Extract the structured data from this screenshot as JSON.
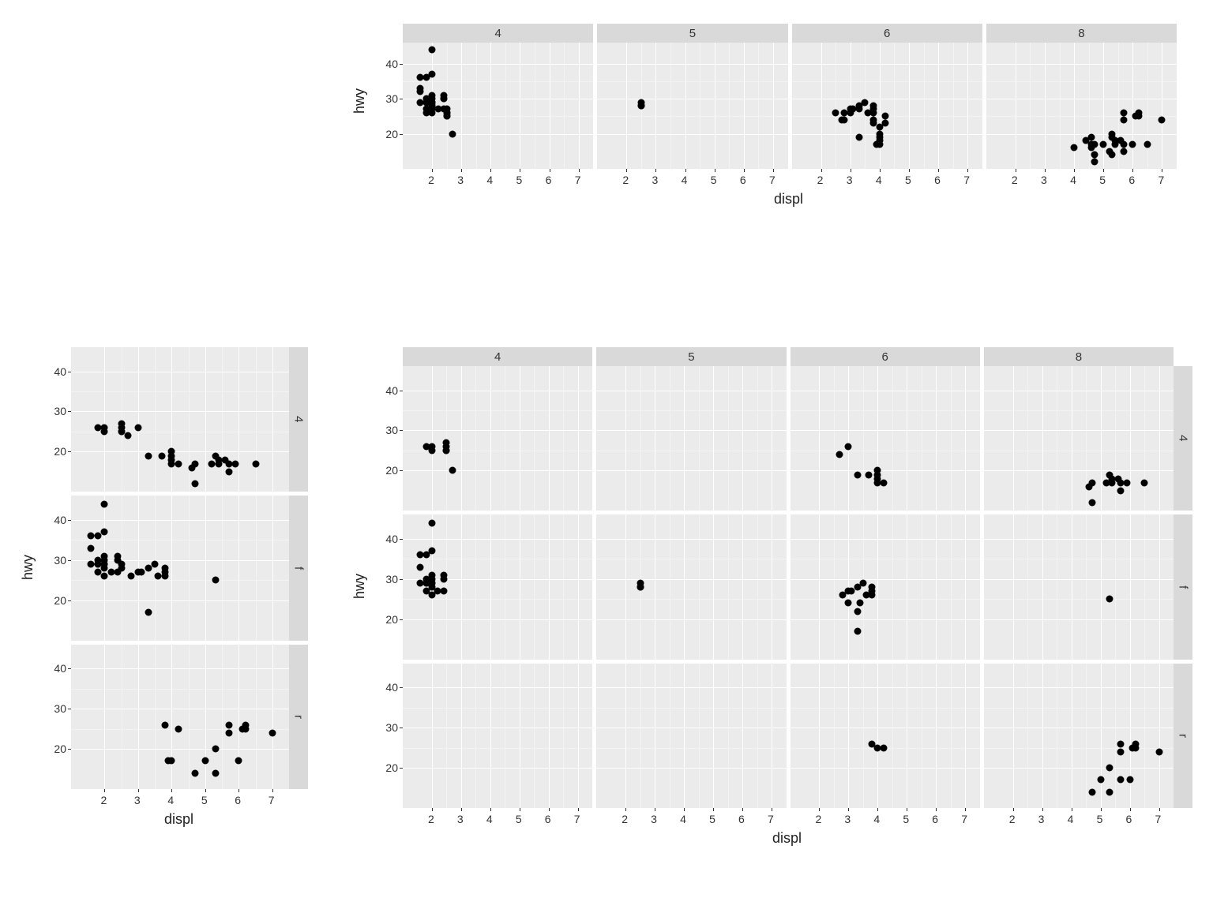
{
  "chart_data": [
    {
      "id": "A_top_right",
      "type": "scatter",
      "facets_col": [
        "4",
        "5",
        "6",
        "8"
      ],
      "xlabel": "displ",
      "ylabel": "hwy",
      "xlim": [
        1,
        7.5
      ],
      "ylim": [
        10,
        46
      ],
      "x_ticks": [
        2,
        3,
        4,
        5,
        6,
        7
      ],
      "y_ticks": [
        20,
        30,
        40
      ],
      "series_by_col": {
        "4": [
          [
            1.6,
            33
          ],
          [
            1.6,
            29
          ],
          [
            1.6,
            32
          ],
          [
            1.6,
            36
          ],
          [
            1.8,
            29
          ],
          [
            1.8,
            29
          ],
          [
            1.8,
            30
          ],
          [
            1.8,
            26
          ],
          [
            1.8,
            27
          ],
          [
            1.8,
            36
          ],
          [
            2.0,
            31
          ],
          [
            2.0,
            26
          ],
          [
            2.0,
            29
          ],
          [
            2.0,
            28
          ],
          [
            2.0,
            30
          ],
          [
            2.0,
            29
          ],
          [
            2.0,
            28
          ],
          [
            2.0,
            27
          ],
          [
            2.0,
            29
          ],
          [
            2.0,
            29
          ],
          [
            2.0,
            37
          ],
          [
            2.0,
            44
          ],
          [
            2.2,
            27
          ],
          [
            2.4,
            30
          ],
          [
            2.4,
            31
          ],
          [
            2.4,
            27
          ],
          [
            2.4,
            30
          ],
          [
            2.5,
            25
          ],
          [
            2.5,
            26
          ],
          [
            2.5,
            27
          ],
          [
            2.5,
            26
          ],
          [
            2.5,
            25
          ],
          [
            2.5,
            25
          ],
          [
            2.7,
            20
          ]
        ],
        "5": [
          [
            2.5,
            28
          ],
          [
            2.5,
            29
          ],
          [
            2.5,
            28
          ],
          [
            2.5,
            28
          ]
        ],
        "6": [
          [
            2.5,
            26
          ],
          [
            2.7,
            24
          ],
          [
            2.8,
            26
          ],
          [
            2.8,
            24
          ],
          [
            3.0,
            26
          ],
          [
            3.0,
            27
          ],
          [
            3.1,
            27
          ],
          [
            3.3,
            28
          ],
          [
            3.3,
            27
          ],
          [
            3.3,
            19
          ],
          [
            3.5,
            29
          ],
          [
            3.6,
            26
          ],
          [
            3.8,
            26
          ],
          [
            3.8,
            28
          ],
          [
            3.8,
            27
          ],
          [
            3.8,
            23
          ],
          [
            3.8,
            24
          ],
          [
            3.9,
            17
          ],
          [
            4.0,
            17
          ],
          [
            4.0,
            19
          ],
          [
            4.0,
            20
          ],
          [
            4.0,
            18
          ],
          [
            4.0,
            22
          ],
          [
            4.2,
            25
          ],
          [
            4.2,
            23
          ]
        ],
        "8": [
          [
            4.0,
            16
          ],
          [
            4.4,
            18
          ],
          [
            4.6,
            16
          ],
          [
            4.6,
            17
          ],
          [
            4.6,
            19
          ],
          [
            4.7,
            17
          ],
          [
            4.7,
            12
          ],
          [
            4.7,
            14
          ],
          [
            5.0,
            17
          ],
          [
            5.2,
            15
          ],
          [
            5.3,
            19
          ],
          [
            5.3,
            20
          ],
          [
            5.3,
            14
          ],
          [
            5.4,
            17
          ],
          [
            5.4,
            18
          ],
          [
            5.6,
            18
          ],
          [
            5.7,
            26
          ],
          [
            5.7,
            17
          ],
          [
            5.7,
            15
          ],
          [
            5.7,
            24
          ],
          [
            6.0,
            17
          ],
          [
            6.1,
            25
          ],
          [
            6.2,
            26
          ],
          [
            6.2,
            25
          ],
          [
            6.5,
            17
          ],
          [
            7.0,
            24
          ]
        ]
      }
    },
    {
      "id": "B_bottom_left",
      "type": "scatter",
      "facets_row": [
        "4",
        "f",
        "r"
      ],
      "xlabel": "displ",
      "ylabel": "hwy",
      "xlim": [
        1,
        7.5
      ],
      "ylim": [
        10,
        46
      ],
      "x_ticks": [
        2,
        3,
        4,
        5,
        6,
        7
      ],
      "y_ticks": [
        20,
        30,
        40
      ],
      "series_by_row": {
        "4": [
          [
            1.8,
            26
          ],
          [
            2.0,
            26
          ],
          [
            2.0,
            25
          ],
          [
            2.5,
            26
          ],
          [
            2.5,
            25
          ],
          [
            2.5,
            27
          ],
          [
            2.5,
            25
          ],
          [
            2.7,
            24
          ],
          [
            3.0,
            26
          ],
          [
            3.3,
            19
          ],
          [
            3.7,
            19
          ],
          [
            4.0,
            17
          ],
          [
            4.0,
            20
          ],
          [
            4.0,
            18
          ],
          [
            4.0,
            19
          ],
          [
            4.2,
            17
          ],
          [
            4.6,
            16
          ],
          [
            4.7,
            17
          ],
          [
            4.7,
            12
          ],
          [
            5.2,
            17
          ],
          [
            5.3,
            19
          ],
          [
            5.4,
            17
          ],
          [
            5.4,
            18
          ],
          [
            5.6,
            18
          ],
          [
            5.7,
            17
          ],
          [
            5.7,
            15
          ],
          [
            5.9,
            17
          ],
          [
            6.5,
            17
          ]
        ],
        "f": [
          [
            1.6,
            33
          ],
          [
            1.6,
            29
          ],
          [
            1.6,
            36
          ],
          [
            1.8,
            29
          ],
          [
            1.8,
            29
          ],
          [
            1.8,
            30
          ],
          [
            1.8,
            27
          ],
          [
            1.8,
            36
          ],
          [
            2.0,
            31
          ],
          [
            2.0,
            26
          ],
          [
            2.0,
            29
          ],
          [
            2.0,
            28
          ],
          [
            2.0,
            30
          ],
          [
            2.0,
            29
          ],
          [
            2.0,
            37
          ],
          [
            2.0,
            44
          ],
          [
            2.2,
            27
          ],
          [
            2.4,
            30
          ],
          [
            2.4,
            31
          ],
          [
            2.4,
            27
          ],
          [
            2.5,
            28
          ],
          [
            2.5,
            29
          ],
          [
            2.8,
            26
          ],
          [
            3.0,
            27
          ],
          [
            3.1,
            27
          ],
          [
            3.3,
            28
          ],
          [
            3.3,
            17
          ],
          [
            3.5,
            29
          ],
          [
            3.6,
            26
          ],
          [
            3.8,
            26
          ],
          [
            3.8,
            28
          ],
          [
            3.8,
            27
          ],
          [
            5.3,
            25
          ]
        ],
        "r": [
          [
            3.8,
            26
          ],
          [
            3.9,
            17
          ],
          [
            4.0,
            17
          ],
          [
            4.2,
            25
          ],
          [
            4.7,
            14
          ],
          [
            5.0,
            17
          ],
          [
            5.3,
            20
          ],
          [
            5.3,
            14
          ],
          [
            5.7,
            26
          ],
          [
            5.7,
            24
          ],
          [
            6.0,
            17
          ],
          [
            6.1,
            25
          ],
          [
            6.2,
            26
          ],
          [
            6.2,
            25
          ],
          [
            7.0,
            24
          ]
        ]
      }
    },
    {
      "id": "C_bottom_right_grid",
      "type": "scatter",
      "facets_col": [
        "4",
        "5",
        "6",
        "8"
      ],
      "facets_row": [
        "4",
        "f",
        "r"
      ],
      "xlabel": "displ",
      "ylabel": "hwy",
      "xlim": [
        1,
        7.5
      ],
      "ylim": [
        10,
        46
      ],
      "x_ticks": [
        2,
        3,
        4,
        5,
        6,
        7
      ],
      "y_ticks": [
        20,
        30,
        40
      ],
      "series_by_cell": {
        "4|4": [
          [
            1.8,
            26
          ],
          [
            2.0,
            26
          ],
          [
            2.0,
            25
          ],
          [
            2.5,
            26
          ],
          [
            2.5,
            25
          ],
          [
            2.5,
            27
          ],
          [
            2.5,
            25
          ],
          [
            2.7,
            20
          ]
        ],
        "4|5": [],
        "4|6": [
          [
            2.7,
            24
          ],
          [
            3.0,
            26
          ],
          [
            3.3,
            19
          ],
          [
            3.7,
            19
          ],
          [
            4.0,
            17
          ],
          [
            4.0,
            20
          ],
          [
            4.0,
            18
          ],
          [
            4.0,
            19
          ],
          [
            4.2,
            17
          ]
        ],
        "4|8": [
          [
            4.6,
            16
          ],
          [
            4.7,
            17
          ],
          [
            4.7,
            12
          ],
          [
            5.2,
            17
          ],
          [
            5.3,
            19
          ],
          [
            5.4,
            17
          ],
          [
            5.4,
            18
          ],
          [
            5.6,
            18
          ],
          [
            5.7,
            17
          ],
          [
            5.7,
            15
          ],
          [
            5.9,
            17
          ],
          [
            6.5,
            17
          ]
        ],
        "f|4": [
          [
            1.6,
            33
          ],
          [
            1.6,
            29
          ],
          [
            1.6,
            36
          ],
          [
            1.8,
            29
          ],
          [
            1.8,
            29
          ],
          [
            1.8,
            30
          ],
          [
            1.8,
            27
          ],
          [
            1.8,
            36
          ],
          [
            2.0,
            31
          ],
          [
            2.0,
            26
          ],
          [
            2.0,
            29
          ],
          [
            2.0,
            28
          ],
          [
            2.0,
            30
          ],
          [
            2.0,
            29
          ],
          [
            2.0,
            37
          ],
          [
            2.0,
            44
          ],
          [
            2.2,
            27
          ],
          [
            2.4,
            30
          ],
          [
            2.4,
            31
          ],
          [
            2.4,
            27
          ]
        ],
        "f|5": [
          [
            2.5,
            28
          ],
          [
            2.5,
            29
          ],
          [
            2.5,
            28
          ],
          [
            2.5,
            28
          ]
        ],
        "f|6": [
          [
            2.8,
            26
          ],
          [
            3.0,
            27
          ],
          [
            3.1,
            27
          ],
          [
            3.3,
            28
          ],
          [
            3.3,
            17
          ],
          [
            3.5,
            29
          ],
          [
            3.6,
            26
          ],
          [
            3.8,
            26
          ],
          [
            3.8,
            28
          ],
          [
            3.8,
            27
          ],
          [
            3.3,
            22
          ],
          [
            3.4,
            24
          ],
          [
            3.0,
            24
          ]
        ],
        "f|8": [
          [
            5.3,
            25
          ]
        ],
        "r|4": [],
        "r|5": [],
        "r|6": [
          [
            3.8,
            26
          ],
          [
            4.0,
            25
          ],
          [
            4.2,
            25
          ]
        ],
        "r|8": [
          [
            4.7,
            14
          ],
          [
            5.0,
            17
          ],
          [
            5.3,
            20
          ],
          [
            5.3,
            14
          ],
          [
            5.7,
            26
          ],
          [
            5.7,
            24
          ],
          [
            5.7,
            17
          ],
          [
            6.0,
            17
          ],
          [
            6.1,
            25
          ],
          [
            6.2,
            26
          ],
          [
            6.2,
            25
          ],
          [
            7.0,
            24
          ]
        ]
      }
    }
  ]
}
